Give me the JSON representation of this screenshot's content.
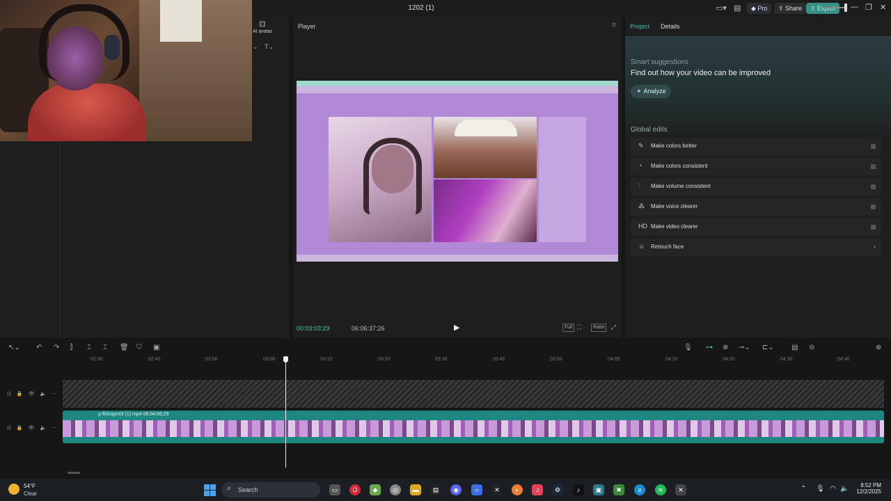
{
  "window": {
    "title": "1202 (1)"
  },
  "titlebar": {
    "pro": "Pro",
    "share": "Share",
    "export": "Export"
  },
  "left_panel": {
    "ai_avatar": "AI avatar"
  },
  "player": {
    "title": "Player",
    "current_time": "00:03:03:29",
    "duration": "06:06:37:26",
    "full_label": "Full",
    "ratio_label": "Ratio"
  },
  "right_panel": {
    "tabs": [
      "Project",
      "Details"
    ],
    "smart_title": "Smart suggestions",
    "smart_headline": "Find out how your video can be improved",
    "analyze": "Analyze",
    "global_title": "Global edits",
    "edits": [
      {
        "label": "Make colors better",
        "icon": "magic-wand-icon"
      },
      {
        "label": "Make colors consistent",
        "icon": "color-sync-icon"
      },
      {
        "label": "Make volume consistent",
        "icon": "sliders-icon"
      },
      {
        "label": "Make voice clearer",
        "icon": "voice-icon"
      },
      {
        "label": "Make video clearer",
        "icon": "hd-icon"
      },
      {
        "label": "Retouch face",
        "icon": "face-icon"
      }
    ]
  },
  "timeline": {
    "ruler": [
      "02:30",
      "02:40",
      "02:50",
      "03:00",
      "03:10",
      "03:20",
      "03:30",
      "03:40",
      "03:50",
      "04:00",
      "04:10",
      "04:20",
      "04:30",
      "04:40"
    ],
    "clip_name": "p-fk5rqymi3 (1).mp4",
    "clip_duration": "06:04:06:29"
  },
  "taskbar": {
    "temperature": "54°F",
    "condition": "Clear",
    "search": "Search",
    "time": "8:52 PM",
    "date": "12/2/2025"
  }
}
